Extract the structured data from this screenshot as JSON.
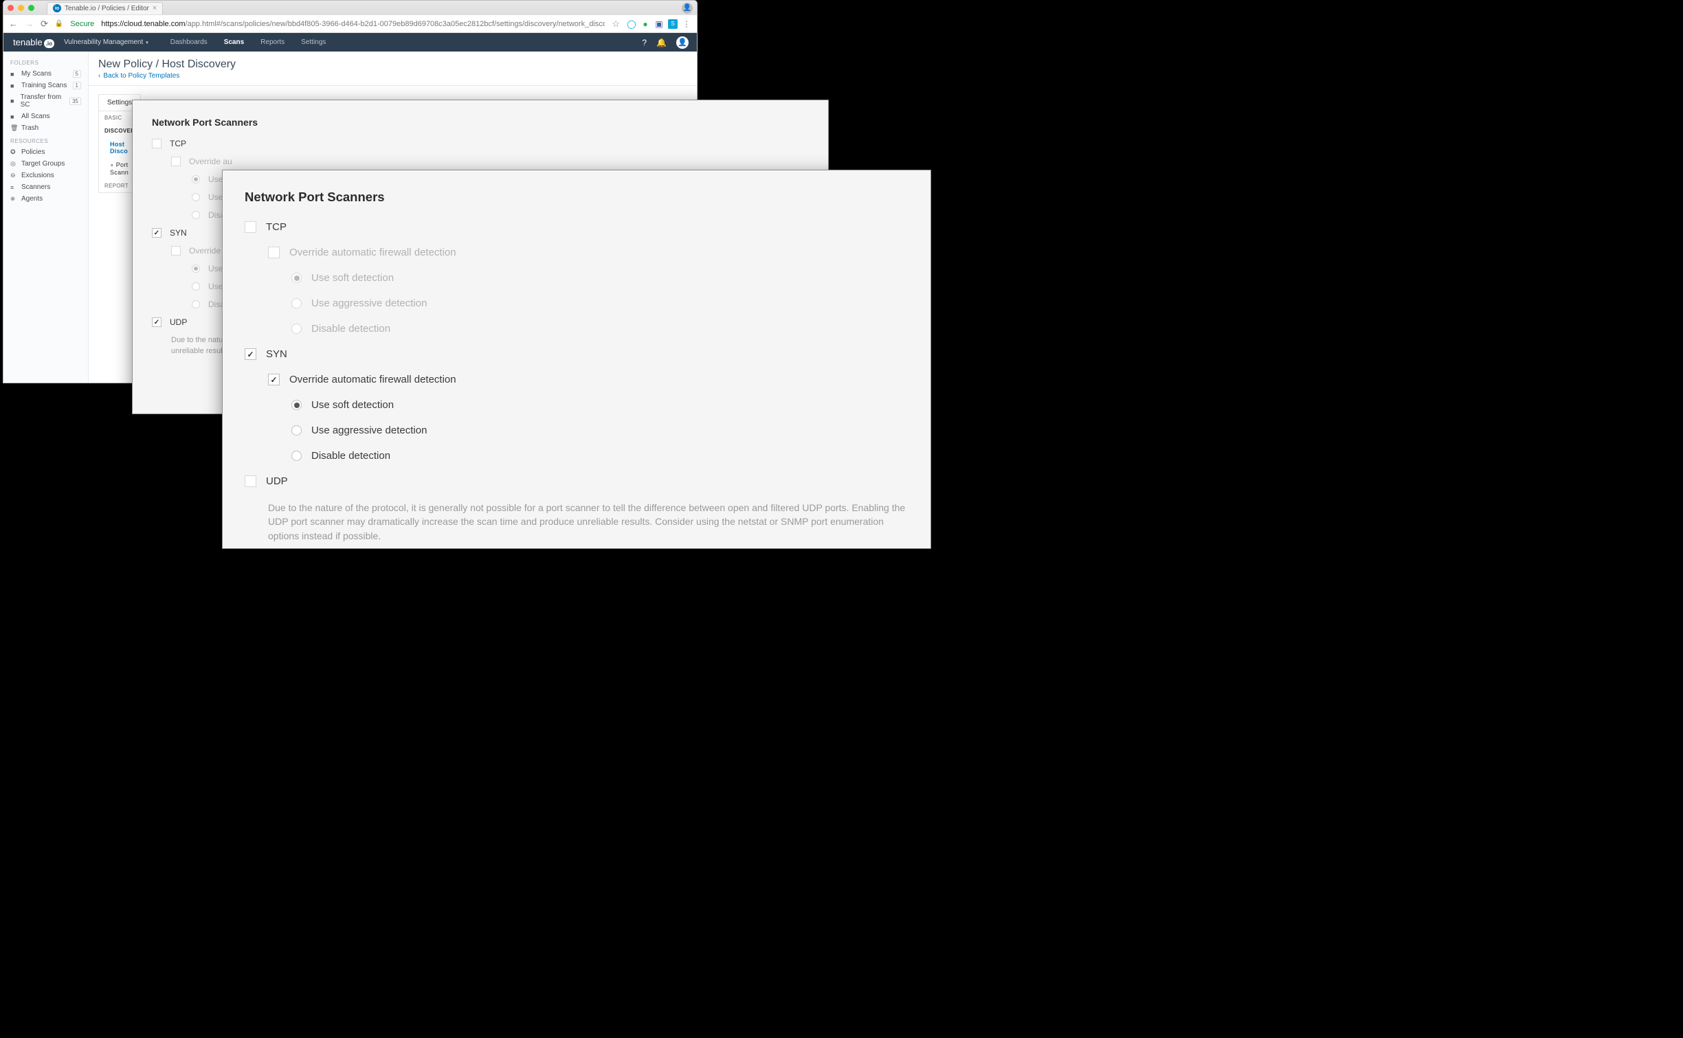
{
  "browser": {
    "tab_title": "Tenable.io / Policies / Editor",
    "secure": "Secure",
    "url_host": "https://cloud.tenable.com",
    "url_path": "/app.html#/scans/policies/new/bbd4f805-3966-d464-b2d1-0079eb89d69708c3a05ec2812bcf/settings/discovery/network_discovery"
  },
  "header": {
    "logo_a": "tenable",
    "logo_b": ".io",
    "product": "Vulnerability Management",
    "nav": [
      "Dashboards",
      "Scans",
      "Reports",
      "Settings"
    ],
    "active_nav": "Scans"
  },
  "sidebar": {
    "folders_label": "FOLDERS",
    "folders": [
      {
        "icon": "📁",
        "label": "My Scans",
        "badge": "5"
      },
      {
        "icon": "📁",
        "label": "Training Scans",
        "badge": "1"
      },
      {
        "icon": "📁",
        "label": "Transfer from SC",
        "badge": "35"
      },
      {
        "icon": "📁",
        "label": "All Scans",
        "badge": ""
      },
      {
        "icon": "🗑",
        "label": "Trash",
        "badge": ""
      }
    ],
    "resources_label": "RESOURCES",
    "resources": [
      {
        "icon": "✪",
        "label": "Policies"
      },
      {
        "icon": "◎",
        "label": "Target Groups"
      },
      {
        "icon": "⊖",
        "label": "Exclusions"
      },
      {
        "icon": "≡",
        "label": "Scanners"
      },
      {
        "icon": "⎈",
        "label": "Agents"
      }
    ]
  },
  "page_title": "New Policy / Host Discovery",
  "back_link": "Back to Policy Templates",
  "tab_label": "Settings",
  "settings_nav": {
    "basic": "BASIC",
    "discovery": "DISCOVERY",
    "host": "Host Discovery",
    "port": "Port Scanning",
    "report": "REPORT"
  },
  "form": {
    "title": "Network Port Scanners",
    "tcp": "TCP",
    "override": "Override automatic firewall detection",
    "soft": "Use soft detection",
    "aggressive": "Use aggressive detection",
    "disable": "Disable detection",
    "syn": "SYN",
    "udp": "UDP",
    "udp_note": "Due to the nature of the protocol, it is generally not possible for a port scanner to tell the difference between open and filtered UDP ports. Enabling the UDP port scanner may dramatically increase the scan time and produce unreliable results. Consider using the netstat or SNMP port enumeration options instead if possible.",
    "p1": {
      "override_trunc": "Override automatic firewall detection",
      "soft_t": "Use soft detection",
      "agg_t": "Use aggressive detection",
      "disable_t": "Disable detection",
      "udp_note_t": "Due to the nature of the protocol, it is generally not possible for a port scanner to tell the difference between open and filtered UDP ports. Enabling the UDP port scanner may dramatically increase the scan time and produce unreliable results. Consider using…"
    }
  }
}
